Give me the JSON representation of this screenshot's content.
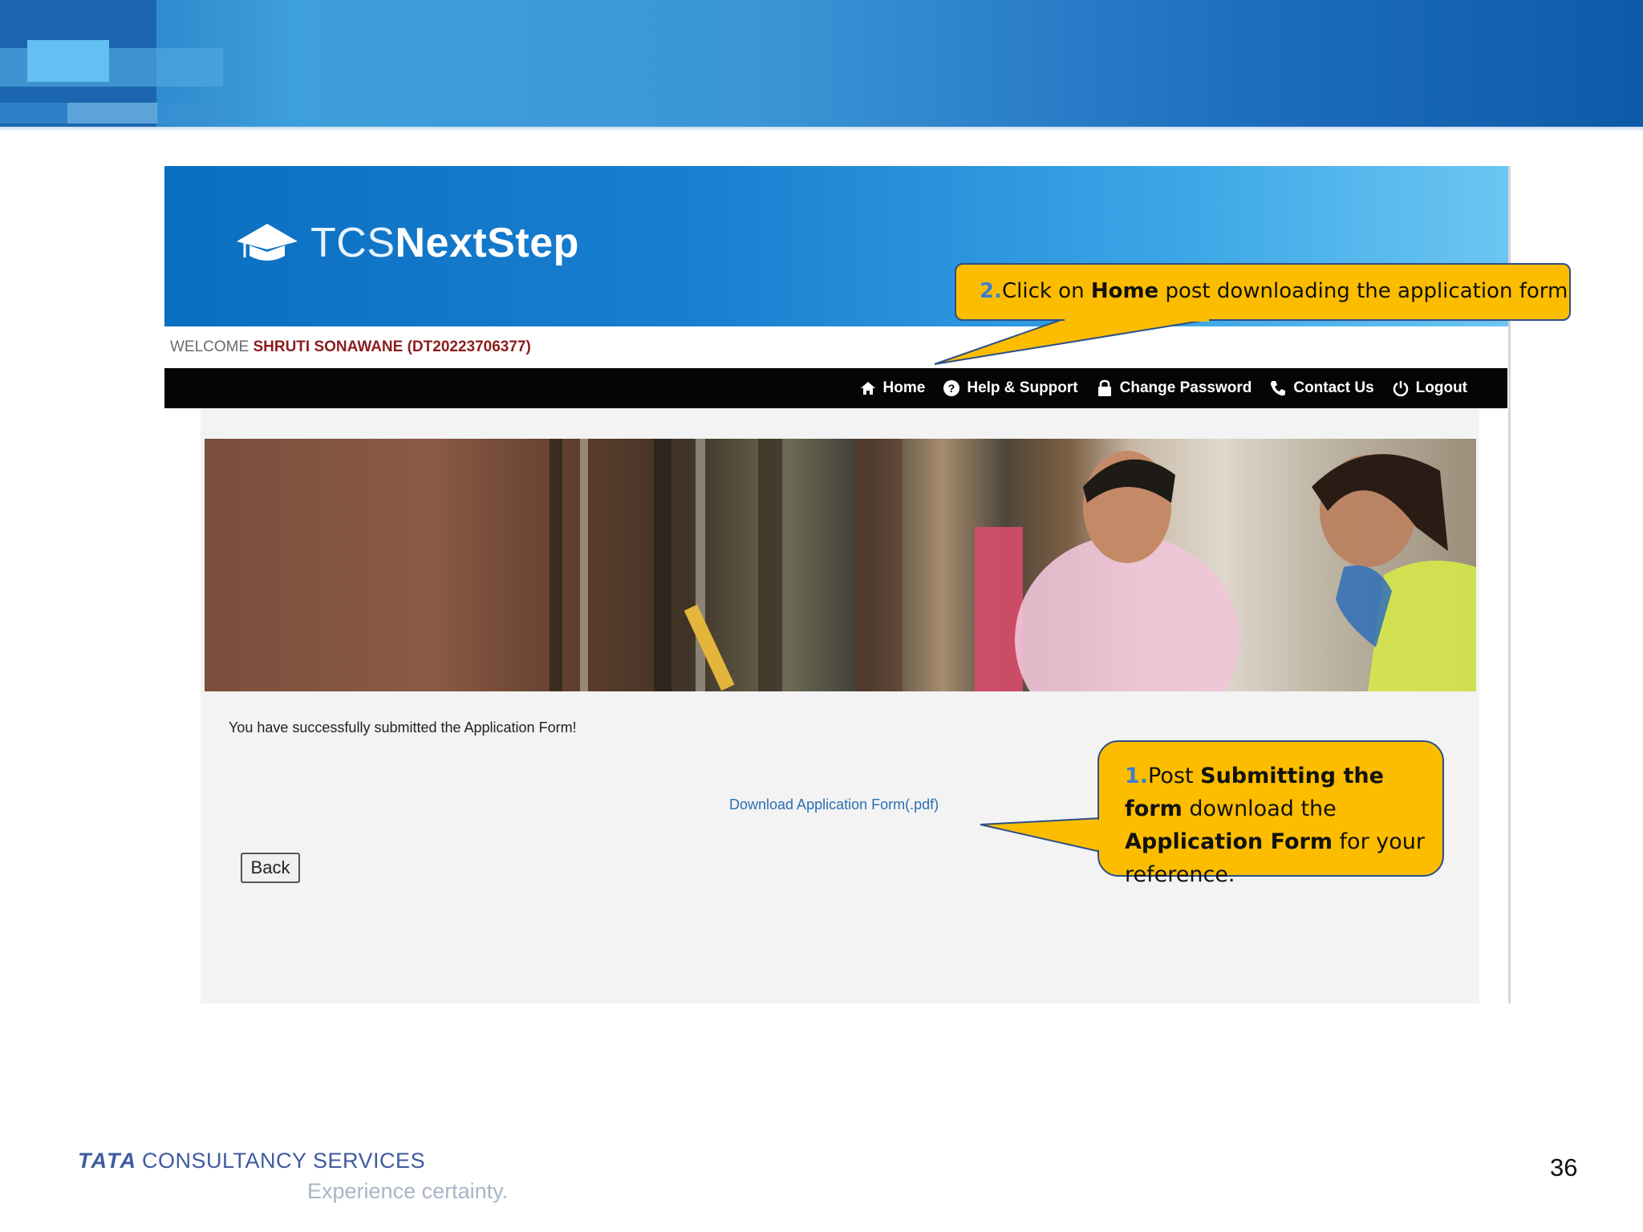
{
  "header": {
    "logo_light": "TCS",
    "logo_bold": "NextStep"
  },
  "welcome": {
    "prefix": "WELCOME",
    "user": "SHRUTI SONAWANE (DT20223706377)"
  },
  "nav": {
    "home": "Home",
    "help": "Help & Support",
    "change_password": "Change Password",
    "contact": "Contact Us",
    "logout": "Logout"
  },
  "content": {
    "success_message": "You have successfully submitted the Application Form!",
    "download_link": "Download Application Form(.pdf)",
    "back_label": "Back"
  },
  "callouts": {
    "home_step": {
      "num": "2.",
      "pre": "Click on ",
      "bold": "Home",
      "post": " post downloading the application form"
    },
    "download_step": {
      "num": "1.",
      "pre": "Post ",
      "bold1": "Submitting the form",
      "mid": " download the ",
      "bold2": "Application Form",
      "post": " for your reference."
    }
  },
  "footer": {
    "company_bold": "TATA",
    "company": "CONSULTANCY SERVICES",
    "tagline": "Experience certainty.",
    "slide_number": "36"
  },
  "colors": {
    "banner_blue": "#1f6fbf",
    "callout_yellow": "#fcbd00",
    "callout_border": "#2c4f86",
    "nav_black": "#050505",
    "link_blue": "#2c6fb3"
  }
}
